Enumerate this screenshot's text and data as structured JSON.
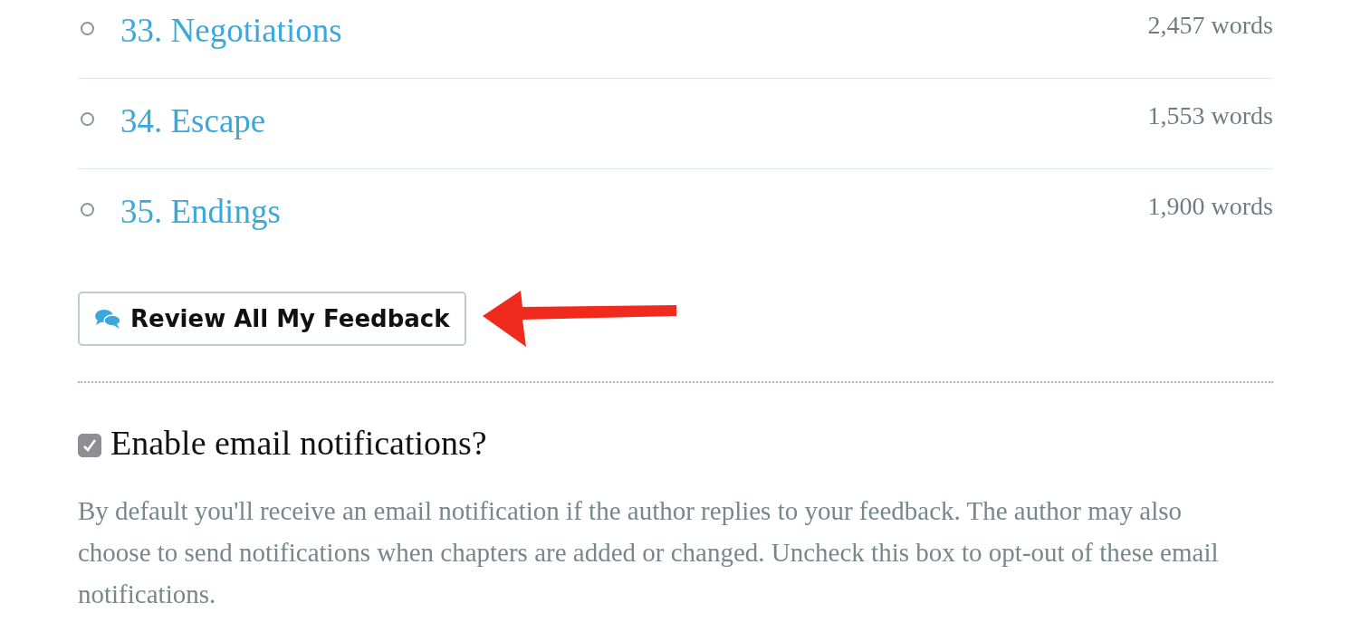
{
  "chapters": [
    {
      "title": "33. Negotiations",
      "words": "2,457 words",
      "read": false
    },
    {
      "title": "34. Escape",
      "words": "1,553 words",
      "read": false
    },
    {
      "title": "35. Endings",
      "words": "1,900 words",
      "read": false
    }
  ],
  "review_button": {
    "label": "Review All My Feedback"
  },
  "notifications": {
    "label": "Enable email notifications?",
    "checked": true,
    "description": "By default you'll receive an email notification if the author replies to your feedback. The author may also choose to send notifications when chapters are added or changed. Uncheck this box to opt-out of these email notifications."
  }
}
